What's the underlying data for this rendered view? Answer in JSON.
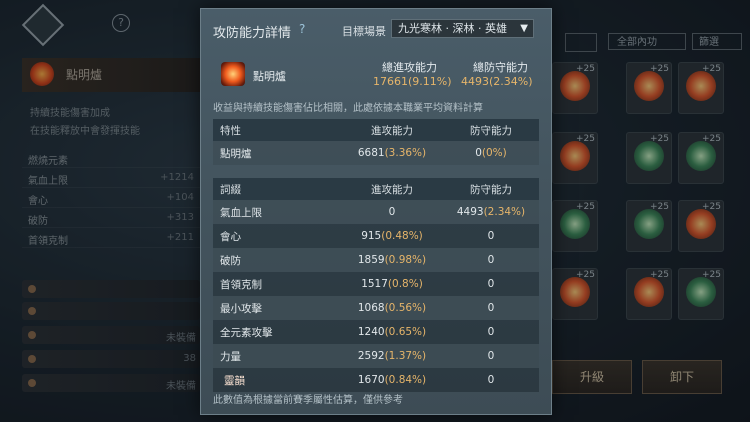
{
  "panel": {
    "title": "攻防能力詳情",
    "help_glyph": "?",
    "target_label": "目標場景",
    "target_value": "九光寒林 · 深林 · 英雄",
    "item_name": "點明爐",
    "total_attack_label": "總進攻能力",
    "total_attack_value": "17661",
    "total_attack_pct": "(9.11%)",
    "total_defense_label": "總防守能力",
    "total_defense_value": "4493",
    "total_defense_pct": "(2.34%)",
    "note": "收益與持續技能傷害佔比相關，此處依據本職業平均資料計算",
    "footer": "此數值為根據當前賽季屬性估算，僅供參考"
  },
  "table_trait": {
    "headers": [
      "特性",
      "進攻能力",
      "防守能力"
    ],
    "rows": [
      {
        "name": "點明爐",
        "atk": "6681",
        "atk_pct": "(3.36%)",
        "def": "0",
        "def_pct": "(0%)"
      }
    ]
  },
  "table_stats": {
    "headers": [
      "詞綴",
      "進攻能力",
      "防守能力"
    ],
    "rows": [
      {
        "name": "氣血上限",
        "atk": "0",
        "atk_pct": "",
        "def": "4493",
        "def_pct": "(2.34%)"
      },
      {
        "name": "會心",
        "atk": "915",
        "atk_pct": "(0.48%)",
        "def": "0",
        "def_pct": ""
      },
      {
        "name": "破防",
        "atk": "1859",
        "atk_pct": "(0.98%)",
        "def": "0",
        "def_pct": ""
      },
      {
        "name": "首領克制",
        "atk": "1517",
        "atk_pct": "(0.8%)",
        "def": "0",
        "def_pct": ""
      },
      {
        "name": "最小攻擊",
        "atk": "1068",
        "atk_pct": "(0.56%)",
        "def": "0",
        "def_pct": ""
      },
      {
        "name": "全元素攻擊",
        "atk": "1240",
        "atk_pct": "(0.65%)",
        "def": "0",
        "def_pct": ""
      },
      {
        "name": "力量",
        "atk": "2592",
        "atk_pct": "(1.37%)",
        "def": "0",
        "def_pct": ""
      },
      {
        "name": "靈韻",
        "atk": "1670",
        "atk_pct": "(0.84%)",
        "def": "0",
        "def_pct": ""
      }
    ]
  },
  "background": {
    "left": {
      "item_name": "點明爐",
      "desc1": "持續技能傷害加成",
      "desc2": "在技能釋放中會發揮技能",
      "rows": [
        {
          "label": "燃燒元素",
          "value": ""
        },
        {
          "label": "氣血上限",
          "value": "+1214"
        },
        {
          "label": "會心",
          "value": "+104"
        },
        {
          "label": "破防",
          "value": "+313"
        },
        {
          "label": "首領克制",
          "value": "+211"
        }
      ],
      "skills": [
        "",
        "",
        "未裝備",
        "38",
        "未裝備"
      ]
    },
    "right": {
      "filter_all": "全部內功",
      "filter": "篩選",
      "upgrade": "升級",
      "unequip": "卸下",
      "plus": "+25"
    }
  }
}
